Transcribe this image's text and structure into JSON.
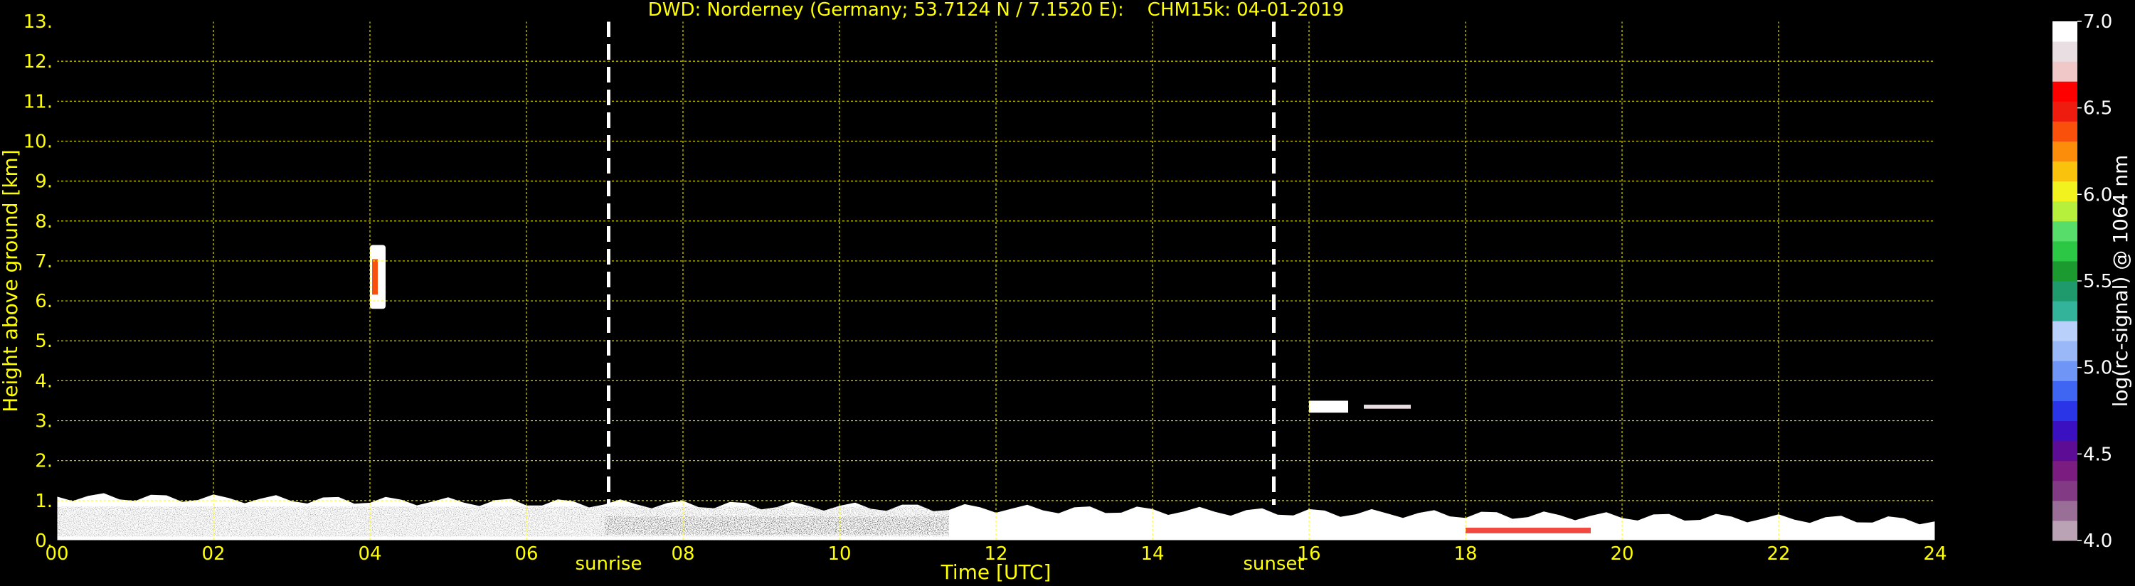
{
  "chart_data": {
    "type": "heatmap",
    "title": "DWD: Norderney (Germany; 53.7124 N / 7.1520 E):    CHM15k: 04-01-2019",
    "xlabel": "Time [UTC]",
    "ylabel": "Height above ground [km]",
    "xlim": [
      0,
      24
    ],
    "ylim": [
      0,
      13
    ],
    "xticks": [
      "00",
      "02",
      "04",
      "06",
      "08",
      "10",
      "12",
      "14",
      "16",
      "18",
      "20",
      "22",
      "24"
    ],
    "yticks": [
      "0.",
      "1.",
      "2.",
      "3.",
      "4.",
      "5.",
      "6.",
      "7.",
      "8.",
      "9.",
      "10.",
      "11.",
      "12.",
      "13."
    ],
    "grid": true,
    "annotations": [
      {
        "label": "sunrise",
        "x": 7.05
      },
      {
        "label": "sunset",
        "x": 15.55
      }
    ],
    "colorbar": {
      "label": "log(rc-signal) @ 1064 nm",
      "range": [
        4.0,
        7.0
      ],
      "ticks": [
        "4.0",
        "4.5",
        "5.0",
        "5.5",
        "6.0",
        "6.5",
        "7.0"
      ],
      "colors": [
        "#b9a3b5",
        "#9a6f97",
        "#833a85",
        "#7a1c80",
        "#5d0c95",
        "#3b10c0",
        "#2a35e8",
        "#3e66f3",
        "#6f95f6",
        "#9ab8f8",
        "#b9d1fa",
        "#33b39a",
        "#1f9a6c",
        "#1b9a2f",
        "#2cc845",
        "#57de6a",
        "#b6f03c",
        "#f2f21f",
        "#f9c20d",
        "#fb8d0b",
        "#f9510c",
        "#ee1b0f",
        "#ff0000",
        "#f0c8c8",
        "#e9dfe2",
        "#ffffff"
      ]
    },
    "features": [
      {
        "label": "boundary layer",
        "x": [
          0,
          24
        ],
        "y_top_km": [
          1.1,
          0.5
        ]
      },
      {
        "label": "cloud",
        "x": [
          4.0,
          4.2
        ],
        "y_km": [
          5.8,
          7.4
        ]
      },
      {
        "label": "cloud",
        "x": [
          16.0,
          17.3
        ],
        "y_km": [
          3.2,
          3.5
        ]
      }
    ]
  }
}
